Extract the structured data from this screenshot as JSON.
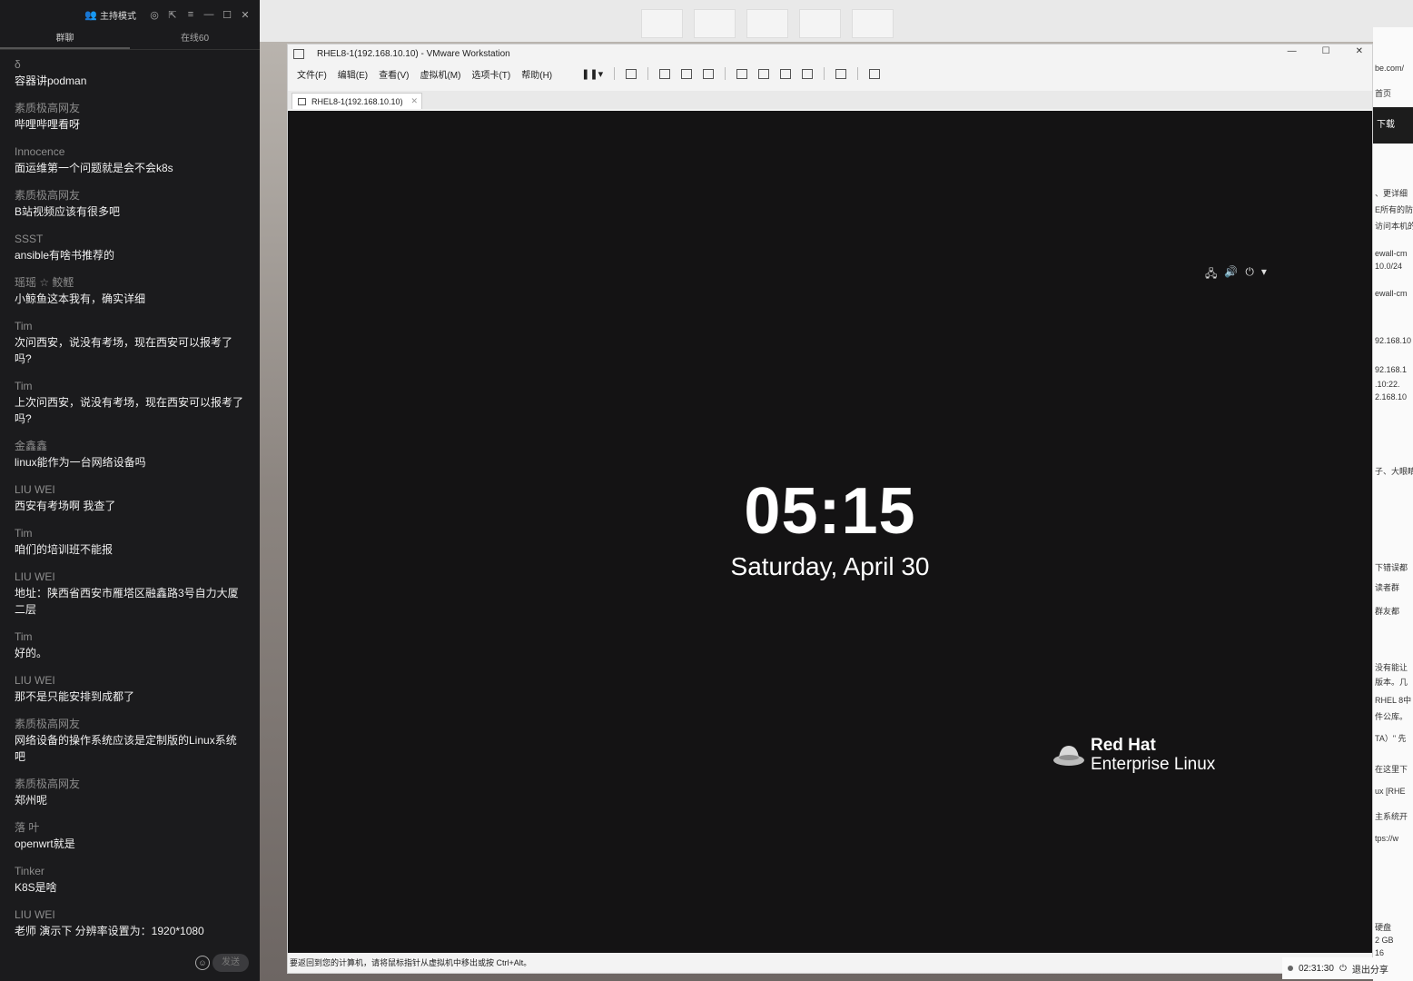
{
  "chat": {
    "top_bar": {
      "host_mode": "主持模式"
    },
    "tabs": [
      {
        "label": "群聊"
      },
      {
        "label": "在线60"
      }
    ],
    "messages": [
      {
        "user": "δ",
        "text": "容器讲podman"
      },
      {
        "user": "素质极高网友",
        "text": "哔哩哔哩看呀"
      },
      {
        "user": "Innocence",
        "text": "面运维第一个问题就是会不会k8s"
      },
      {
        "user": "素质极高网友",
        "text": "B站视频应该有很多吧"
      },
      {
        "user": "SSST",
        "text": "ansible有啥书推荐的"
      },
      {
        "user": "瑶瑶 ☆ 鲛鲣",
        "text": "小鲸鱼这本我有，确实详细"
      },
      {
        "user": "Tim",
        "text": "次问西安，说没有考场，现在西安可以报考了吗?"
      },
      {
        "user": "Tim",
        "text": "上次问西安，说没有考场，现在西安可以报考了吗?"
      },
      {
        "user": "金鑫鑫",
        "text": "linux能作为一台网络设备吗"
      },
      {
        "user": "LIU WEI",
        "text": "西安有考场啊  我查了"
      },
      {
        "user": "Tim",
        "text": "咱们的培训班不能报"
      },
      {
        "user": "LIU WEI",
        "text": "地址：陕西省西安市雁塔区融鑫路3号自力大厦二层"
      },
      {
        "user": "Tim",
        "text": "好的。"
      },
      {
        "user": "LIU WEI",
        "text": "那不是只能安排到成都了"
      },
      {
        "user": "素质极高网友",
        "text": "网络设备的操作系统应该是定制版的Linux系统吧"
      },
      {
        "user": "素质极高网友",
        "text": "郑州呢"
      },
      {
        "user": "  落  叶",
        "text": "openwrt就是"
      },
      {
        "user": "Tinker",
        "text": "K8S是啥"
      },
      {
        "user": "LIU WEI",
        "text": "老师 演示下 分辨率设置为：1920*1080"
      }
    ],
    "send_label": "发送"
  },
  "browser": {
    "lines": [
      "be.com/",
      "首页",
      "、更详细",
      "E所有的防",
      "访问本机的",
      "ewall-cm",
      "10.0/24",
      "ewall-cm",
      "92.168.10",
      "92.168.1",
      ".10:22.",
      "2.168.10",
      "子、大眼睛",
      "下错误都",
      "读者群",
      "群友都",
      "没有能让",
      "版本。几",
      "RHEL 8中",
      "件公库。",
      "TA）\" 先",
      "在这里下",
      "ux [RHE",
      "主系统开",
      "tps://w",
      "硬盘",
      "2 GB",
      "16"
    ],
    "download": "下载"
  },
  "vmware": {
    "title": "RHEL8-1(192.168.10.10) - VMware Workstation",
    "menu": [
      "文件(F)",
      "编辑(E)",
      "查看(V)",
      "虚拟机(M)",
      "选项卡(T)",
      "帮助(H)"
    ],
    "tab_label": "RHEL8-1(192.168.10.10)",
    "status_text": "要返回到您的计算机，请将鼠标指针从虚拟机中移出或按 Ctrl+Alt。",
    "guest": {
      "time": "05:15",
      "date": "Saturday, April 30",
      "brand_line1": "Red Hat",
      "brand_line2": "Enterprise Linux"
    }
  },
  "share": {
    "elapsed": "02:31:30",
    "exit_label": "退出分享"
  }
}
